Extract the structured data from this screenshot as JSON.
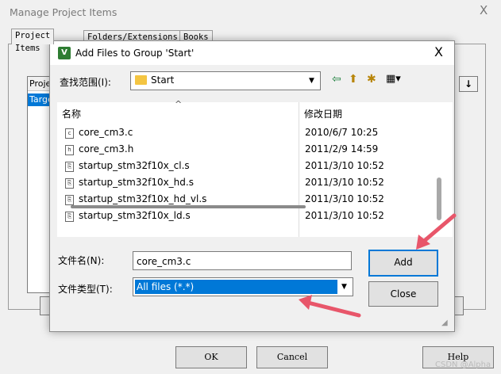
{
  "back_window": {
    "title": "Manage Project Items",
    "close": "X",
    "tabs": [
      {
        "label": "Project Items"
      },
      {
        "label": "Folders/Extensions"
      },
      {
        "label": "Books"
      }
    ],
    "list_header": "Projec",
    "list_selected": "Targe",
    "buttons": {
      "ok": "OK",
      "cancel": "Cancel",
      "help": "Help"
    }
  },
  "dialog": {
    "title": "Add Files to Group 'Start'",
    "close": "X",
    "look_in_label": "查找范围(I):",
    "look_in_value": "Start",
    "columns": {
      "name": "名称",
      "date": "修改日期"
    },
    "files": [
      {
        "name": "core_cm3.c",
        "date": "2010/6/7 10:25",
        "icon": "c-file-icon"
      },
      {
        "name": "core_cm3.h",
        "date": "2011/2/9 14:59",
        "icon": "h-file-icon"
      },
      {
        "name": "startup_stm32f10x_cl.s",
        "date": "2011/3/10 10:52",
        "icon": "asm-file-icon"
      },
      {
        "name": "startup_stm32f10x_hd.s",
        "date": "2011/3/10 10:52",
        "icon": "asm-file-icon"
      },
      {
        "name": "startup_stm32f10x_hd_vl.s",
        "date": "2011/3/10 10:52",
        "icon": "asm-file-icon"
      },
      {
        "name": "startup_stm32f10x_ld.s",
        "date": "2011/3/10 10:52",
        "icon": "asm-file-icon"
      }
    ],
    "file_name_label": "文件名(N):",
    "file_name_value": "core_cm3.c",
    "file_type_label": "文件类型(T):",
    "file_type_value": "All files (*.*)",
    "add_button": "Add",
    "close_button": "Close"
  },
  "watermark": "CSDN @Alpha",
  "colors": {
    "accent": "#0078d7",
    "annotation_arrow": "#e8566a"
  }
}
